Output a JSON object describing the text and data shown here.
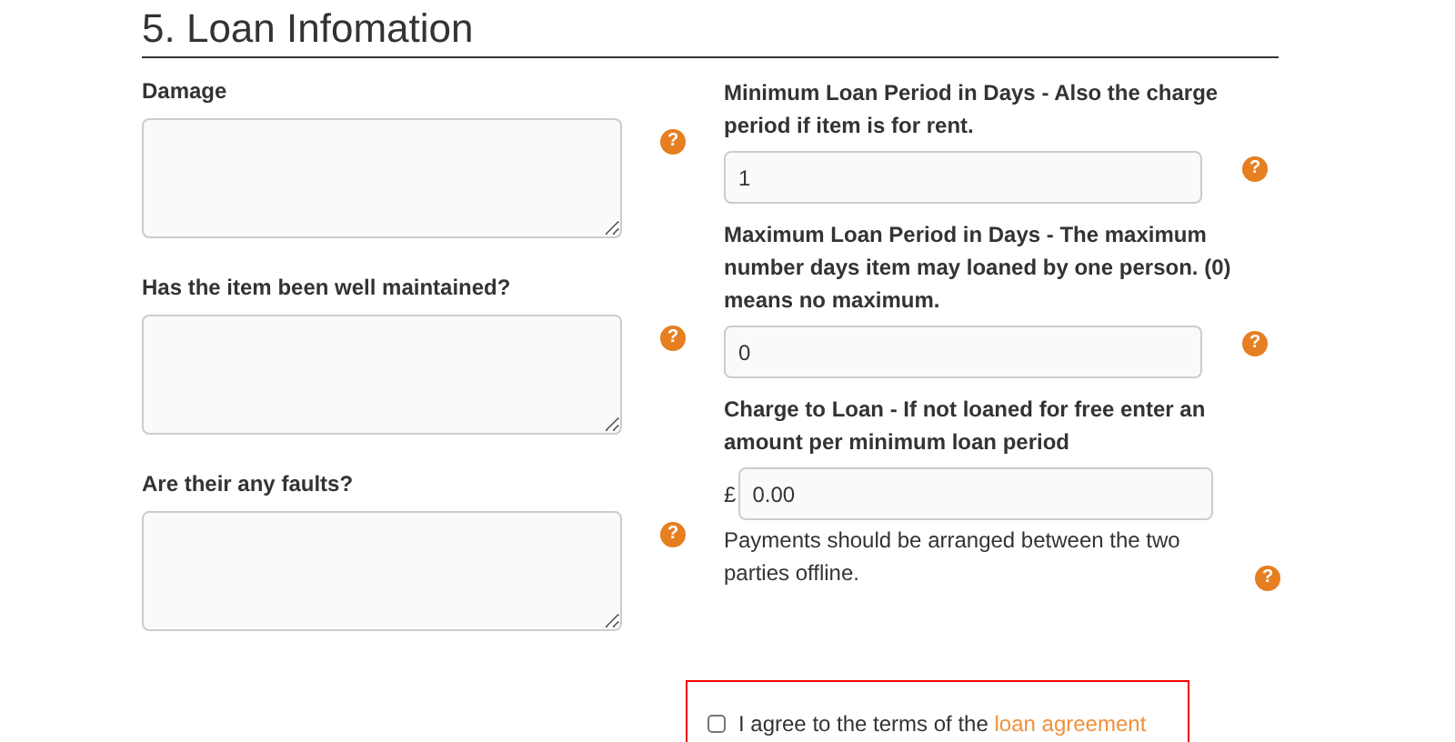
{
  "heading": "5. Loan Infomation",
  "left_fields": [
    {
      "label": "Damage",
      "help": "?"
    },
    {
      "label": "Has the item been well maintained?",
      "help": "?"
    },
    {
      "label": "Are their any faults?",
      "help": "?"
    }
  ],
  "right_fields": [
    {
      "label": "Minimum Loan Period in Days - Also the charge period if item is for rent.",
      "value": "1",
      "help": "?"
    },
    {
      "label": "Maximum Loan Period in Days - The maximum number days item may loaned by one person. (0) means no maximum.",
      "value": "0",
      "help": "?"
    },
    {
      "label": "Charge to Loan - If not loaned for free enter an amount per minimum loan period",
      "prefix": "£",
      "value": "0.00",
      "note": "Payments should be arranged between the two parties offline.",
      "help": "?"
    }
  ],
  "agreement": {
    "text": "I agree to the terms of the",
    "link": "loan agreement",
    "checked": false
  }
}
